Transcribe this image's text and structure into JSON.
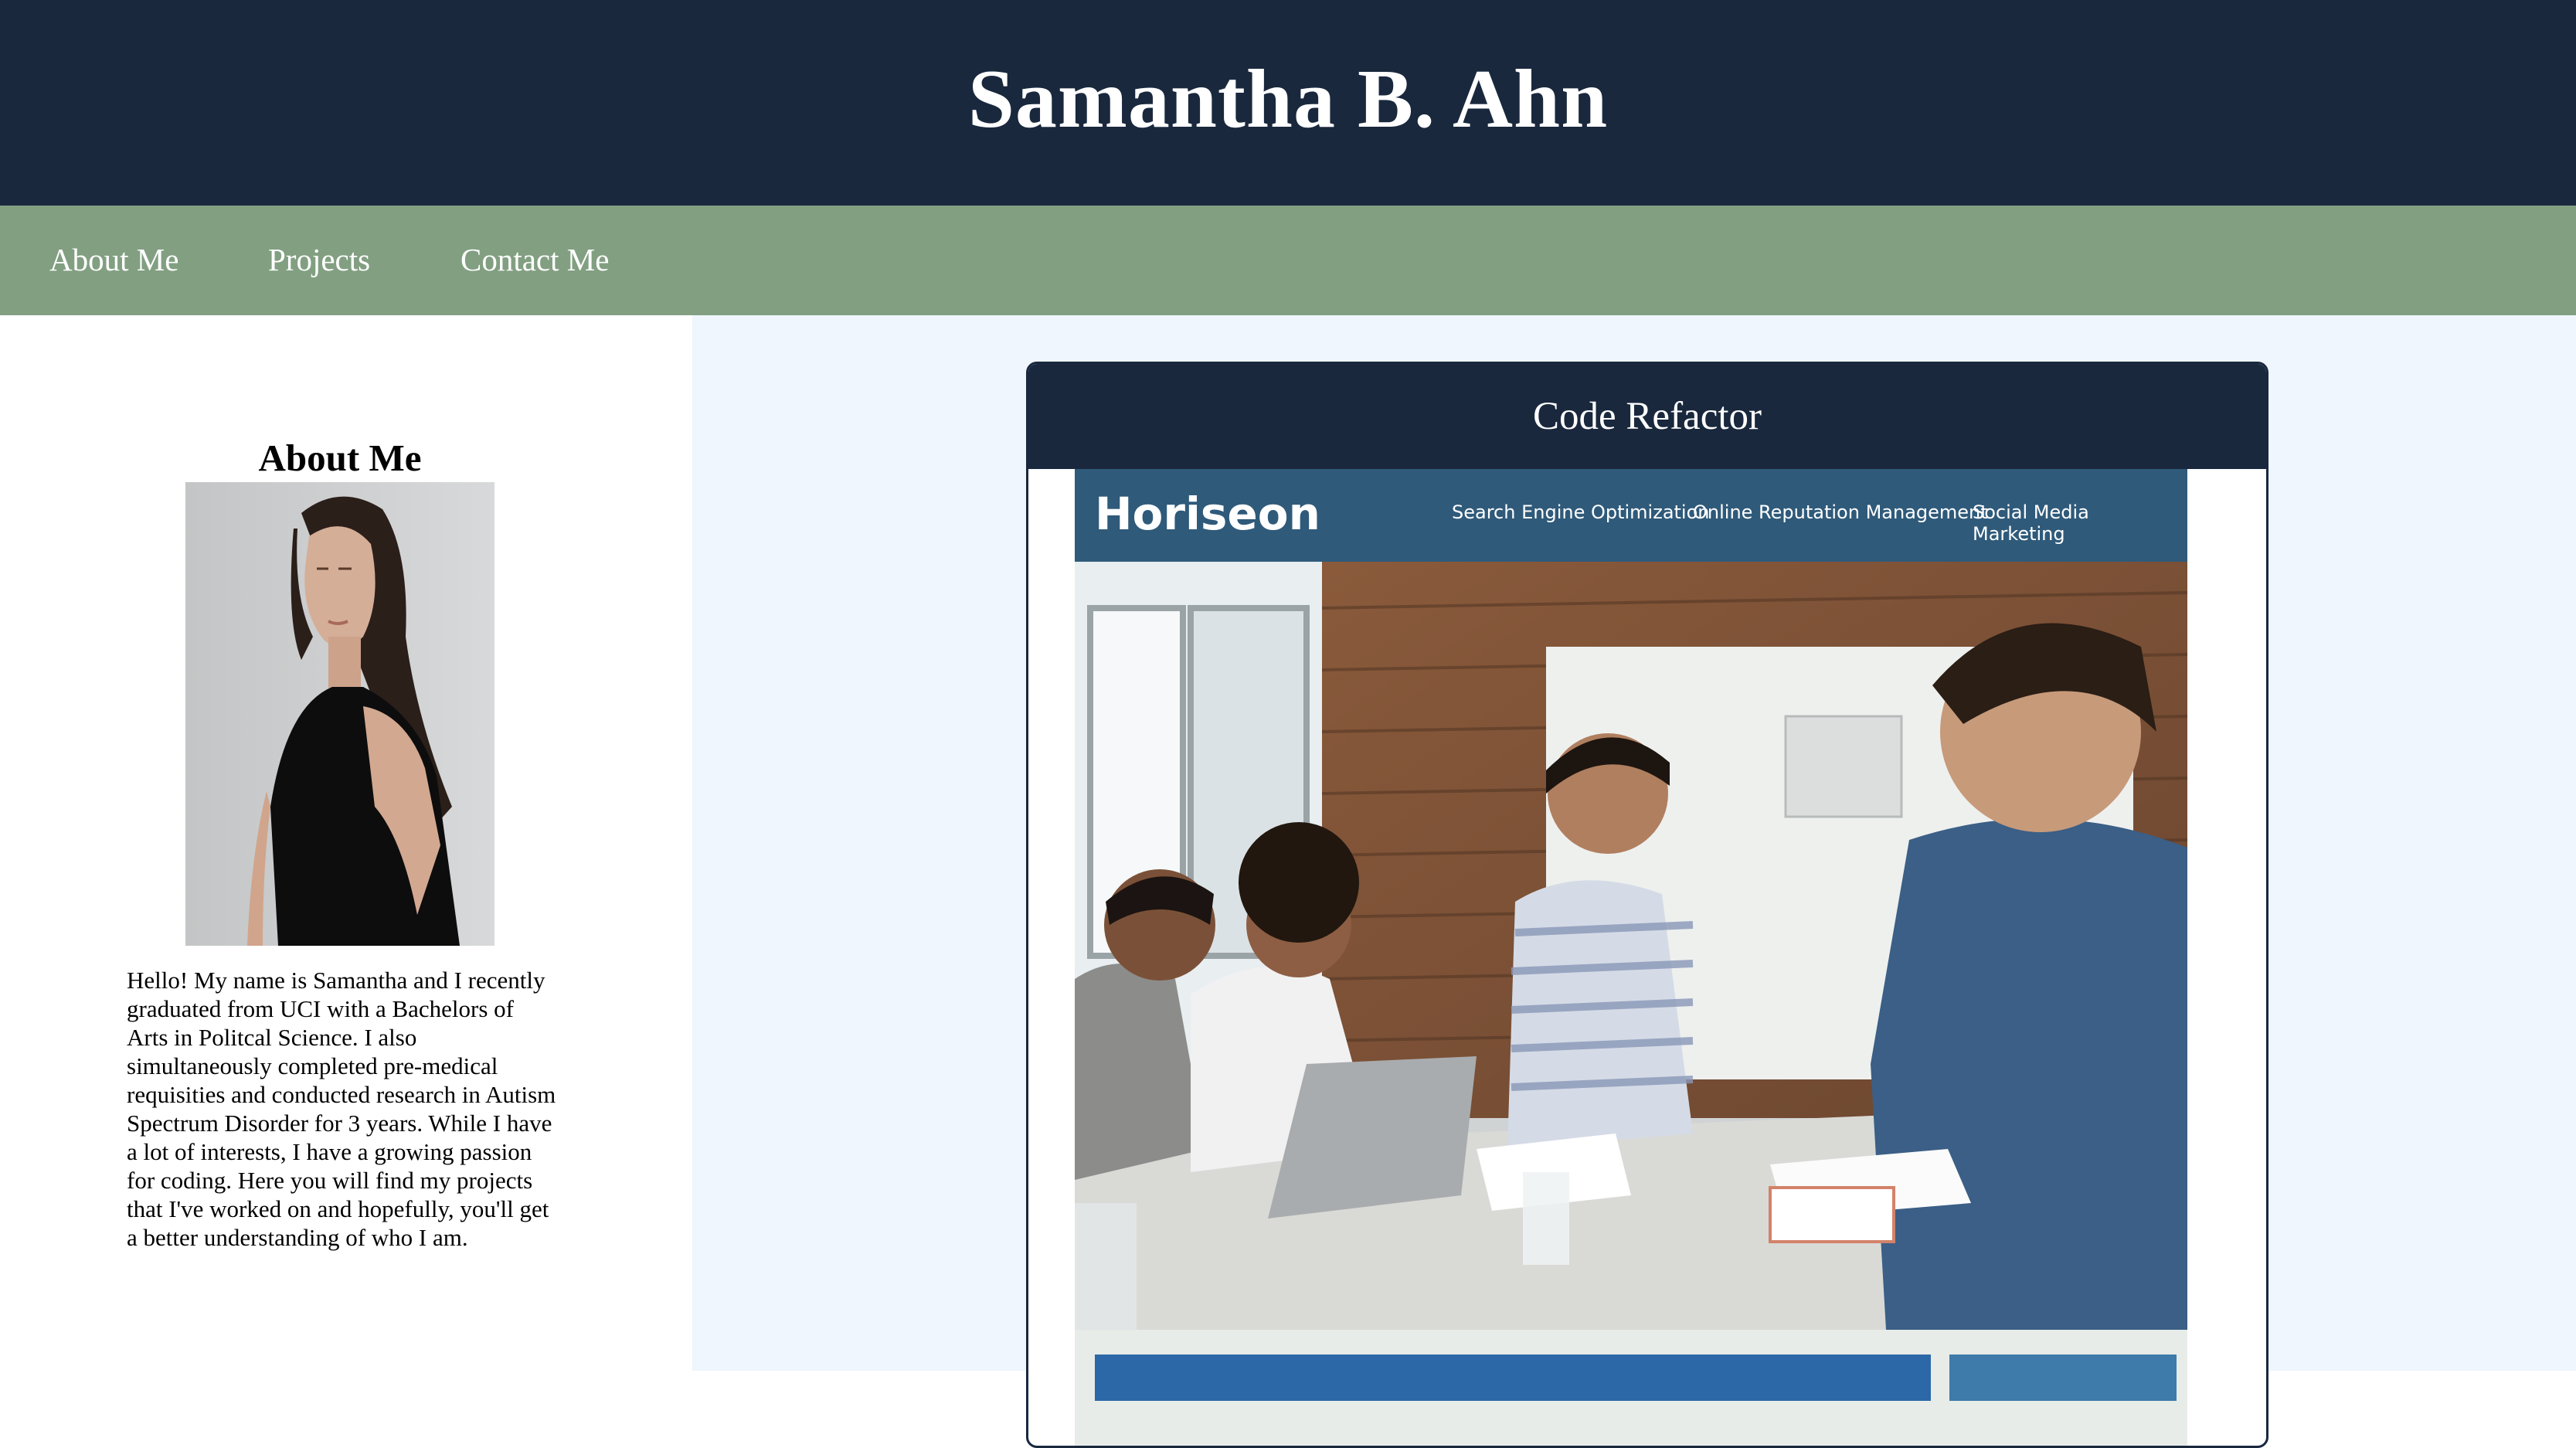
{
  "header": {
    "title": "Samantha B. Ahn"
  },
  "nav": {
    "items": [
      {
        "label": "About Me"
      },
      {
        "label": "Projects"
      },
      {
        "label": "Contact Me"
      }
    ]
  },
  "about": {
    "heading": "About Me",
    "photo": "portrait-photo",
    "bio": "Hello! My name is Samantha and I recently graduated from UCI with a Bachelors of Arts in Politcal Science. I also simultaneously completed pre-medical requisities and conducted research in Autism Spectrum Disorder for 3 years. While I have a lot of interests, I have a growing passion for coding. Here you will find my projects that I've worked on and hopefully, you'll get a better understanding of who I am."
  },
  "projects": [
    {
      "title": "Code Refactor",
      "screenshot": {
        "brand": "Horiseon",
        "links": [
          "Search Engine Optimization",
          "Online Reputation Management",
          "Social Media Marketing"
        ],
        "hero": "meeting-photo"
      }
    }
  ],
  "colors": {
    "header_bg": "#19283d",
    "nav_bg": "#829f82",
    "main_bg": "#eff6fd",
    "horiseon_nav": "#2f5a7a"
  }
}
